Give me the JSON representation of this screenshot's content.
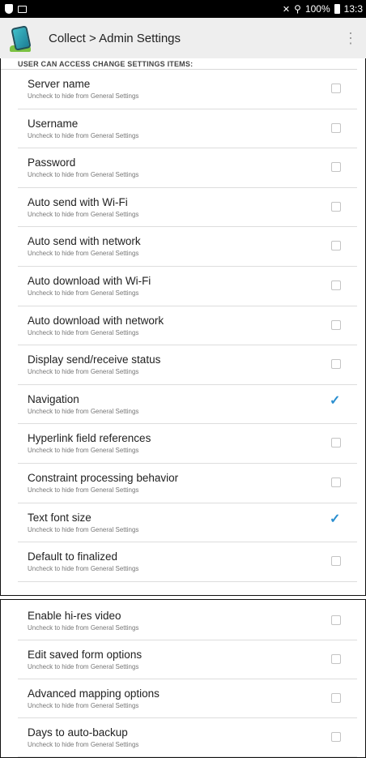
{
  "status_bar": {
    "battery_text": "100%",
    "time": "13:3"
  },
  "app_bar": {
    "title": "Collect > Admin Settings",
    "overflow_icon": "more-vert-icon"
  },
  "section": {
    "header": "USER CAN ACCESS CHANGE SETTINGS ITEMS:"
  },
  "items_panel_1": [
    {
      "title": "Server name",
      "summary": "Uncheck to hide from General Settings",
      "checked": false
    },
    {
      "title": "Username",
      "summary": "Uncheck to hide from General Settings",
      "checked": false
    },
    {
      "title": "Password",
      "summary": "Uncheck to hide from General Settings",
      "checked": false
    },
    {
      "title": "Auto send with Wi-Fi",
      "summary": "Uncheck to hide from General Settings",
      "checked": false
    },
    {
      "title": "Auto send with network",
      "summary": "Uncheck to hide from General Settings",
      "checked": false
    },
    {
      "title": "Auto download with Wi-Fi",
      "summary": "Uncheck to hide from General Settings",
      "checked": false
    },
    {
      "title": "Auto download with network",
      "summary": "Uncheck to hide from General Settings",
      "checked": false
    },
    {
      "title": "Display send/receive status",
      "summary": "Uncheck to hide from General Settings",
      "checked": false
    },
    {
      "title": "Navigation",
      "summary": "Uncheck to hide from General Settings",
      "checked": true
    },
    {
      "title": "Hyperlink field references",
      "summary": "Uncheck to hide from General Settings",
      "checked": false
    },
    {
      "title": "Constraint processing behavior",
      "summary": "Uncheck to hide from General Settings",
      "checked": false
    },
    {
      "title": "Text font size",
      "summary": "Uncheck to hide from General Settings",
      "checked": true
    },
    {
      "title": "Default to finalized",
      "summary": "Uncheck to hide from General Settings",
      "checked": false
    }
  ],
  "items_panel_2": [
    {
      "title": "Enable hi-res video",
      "summary": "Uncheck to hide from General Settings",
      "checked": false
    },
    {
      "title": "Edit saved form options",
      "summary": "Uncheck to hide from General Settings",
      "checked": false
    },
    {
      "title": "Advanced mapping options",
      "summary": "Uncheck to hide from General Settings",
      "checked": false
    },
    {
      "title": "Days to auto-backup",
      "summary": "Uncheck to hide from General Settings",
      "checked": false
    }
  ],
  "colors": {
    "status_bar": "#000000",
    "app_bar": "#eeeeee",
    "accent_check": "#2a8fd0"
  }
}
